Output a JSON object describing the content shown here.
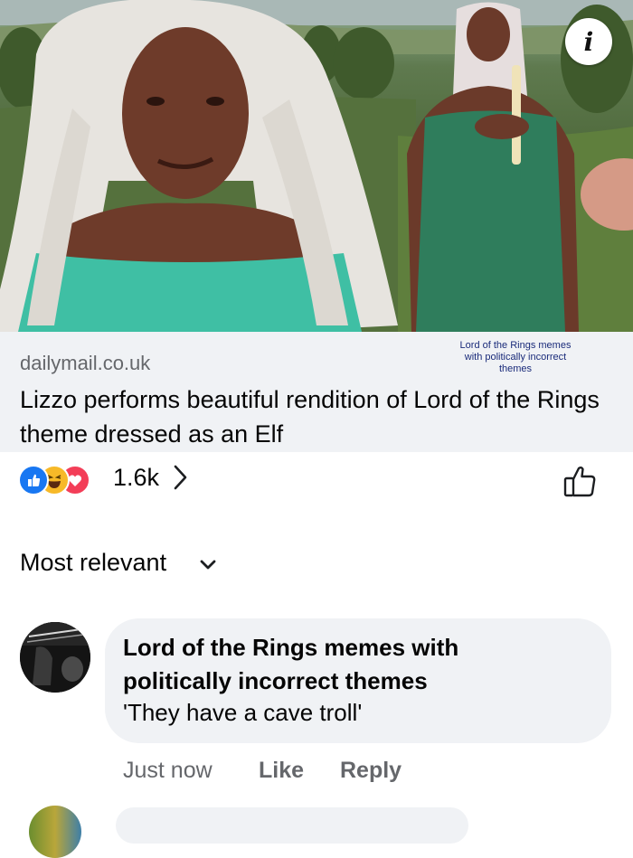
{
  "link_preview": {
    "info_icon": "info-icon",
    "domain": "dailymail.co.uk",
    "title": "Lizzo performs beautiful rendition of Lord of the Rings theme dressed as an Elf",
    "watermark": "Lord of the Rings memes with politically incorrect themes"
  },
  "reactions": {
    "icons": [
      "like-reaction-icon",
      "haha-reaction-icon",
      "love-reaction-icon"
    ],
    "count": "1.6k",
    "colors": {
      "like": "#1877f2",
      "haha": "#f7b928",
      "love": "#f33e58"
    }
  },
  "sort": {
    "label": "Most relevant"
  },
  "comment": {
    "author": "Lord of the Rings memes with politically incorrect themes",
    "text": "'They have a cave troll'",
    "time": "Just now",
    "like_label": "Like",
    "reply_label": "Reply"
  }
}
